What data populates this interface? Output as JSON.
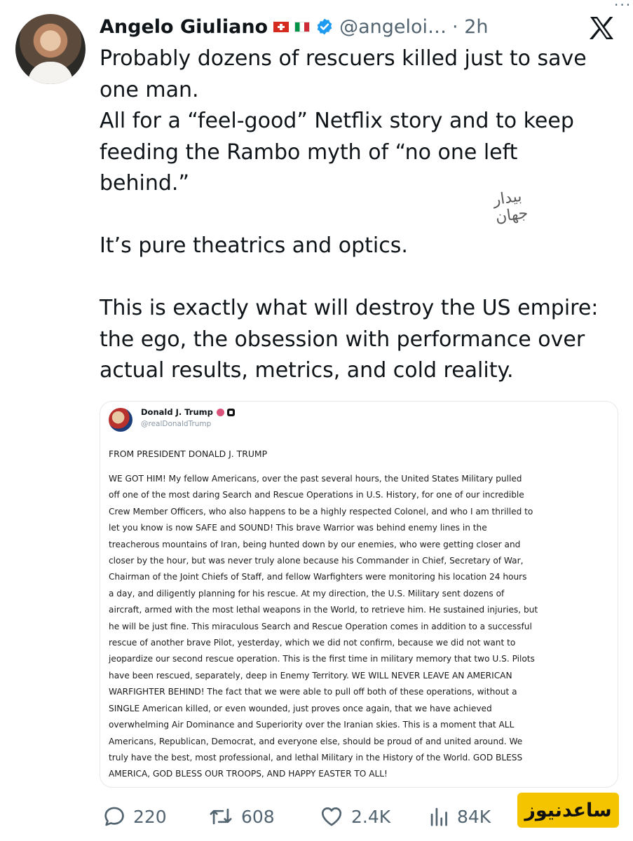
{
  "tweet": {
    "author_name": "Angelo Giuliano",
    "handle": "@angeloi…",
    "time": "· 2h",
    "flags": [
      "swiss-flag-icon",
      "italian-flag-icon"
    ],
    "verified_icon": "verified-badge-icon",
    "platform_icon": "x-logo-icon",
    "more_icon": "more-icon",
    "text_lines": [
      "Probably dozens of rescuers killed just to save",
      "one man.",
      "All for a “feel-good” Netflix story and to keep",
      "feeding the Rambo myth of “no one left",
      "behind.”"
    ],
    "paragraph2": "It’s pure theatrics and optics.",
    "paragraph3_lines": [
      "This is exactly what will destroy the US empire:",
      "the ego, the obsession with performance over",
      "actual results, metrics, and cold reality."
    ]
  },
  "watermark": {
    "text_line1": "جهان",
    "text_line2": "بیدار"
  },
  "embedded_post": {
    "author_name": "Donald J. Trump",
    "handle": "@realDonaldTrump",
    "heading": "FROM PRESIDENT DONALD J. TRUMP",
    "body_lines": [
      "WE GOT HIM! My fellow Americans, over the past several hours, the United States Military pulled",
      "off one of the most daring Search and Rescue Operations in U.S. History, for one of our incredible",
      "Crew Member Officers, who also happens to be a highly respected Colonel, and who I am thrilled to",
      "let you know is now SAFE and SOUND! This brave Warrior was behind enemy lines in the",
      "treacherous mountains of Iran, being hunted down by our enemies, who were getting closer and",
      "closer by the hour, but was never truly alone because his Commander in Chief, Secretary of War,",
      "Chairman of the Joint Chiefs of Staff, and fellow Warfighters were monitoring his location 24 hours",
      "a day, and diligently planning for his rescue. At my direction, the U.S. Military sent dozens of",
      "aircraft, armed with the most lethal weapons in the World, to retrieve him. He sustained injuries, but",
      "he will be just fine. This miraculous Search and Rescue Operation comes in addition to a successful",
      "rescue of another brave Pilot, yesterday, which we did not confirm, because we did not want to",
      "jeopardize our second rescue operation. This is the first time in military memory that two U.S. Pilots",
      "have been rescued, separately, deep in Enemy Territory. WE WILL NEVER LEAVE AN AMERICAN",
      "WARFIGHTER BEHIND! The fact that we were able to pull off both of these operations, without a",
      "SINGLE American killed, or even wounded, just proves once again, that we have achieved",
      "overwhelming Air Dominance and Superiority over the Iranian skies. This is a moment that ALL",
      "Americans, Republican, Democrat, and everyone else, should be proud of and united around. We",
      "truly have the best, most professional, and lethal Military in the History of the World. GOD BLESS",
      "AMERICA, GOD BLESS OUR TROOPS, AND HAPPY EASTER TO ALL!"
    ]
  },
  "actions": {
    "replies": "220",
    "reposts": "608",
    "likes": "2.4K",
    "views": "84K"
  },
  "badge": {
    "text": "ساعدنیوز"
  },
  "colors": {
    "text": "#0f1419",
    "muted": "#536471",
    "badge": "#f5c400",
    "verified": "#1d9bf0"
  }
}
